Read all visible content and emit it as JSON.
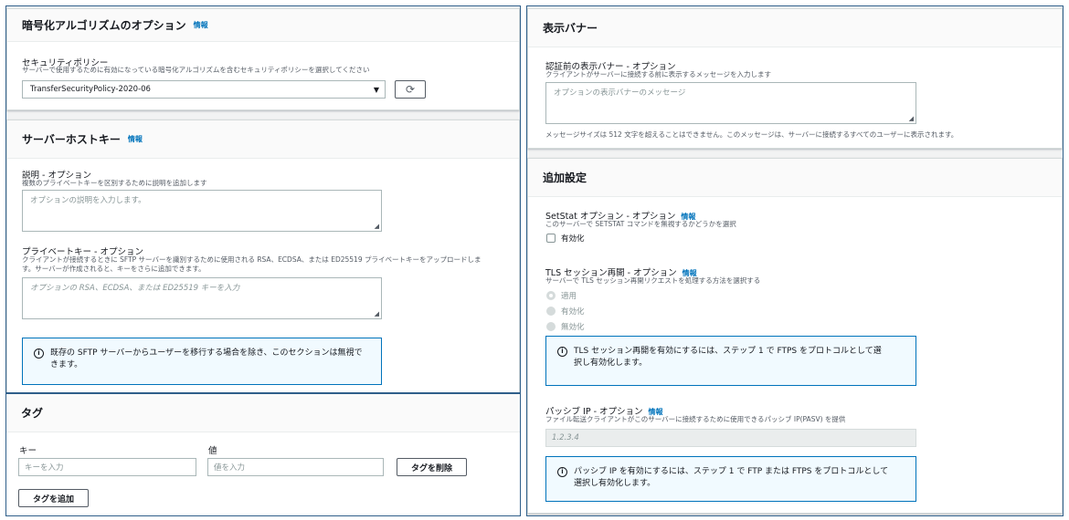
{
  "left": {
    "encryption": {
      "title": "暗号化アルゴリズムのオプション",
      "info": "情報",
      "policy_label": "セキュリティポリシー",
      "policy_desc": "サーバーで使用するために有効になっている暗号化アルゴリズムを含むセキュリティポリシーを選択してください",
      "policy_value": "TransferSecurityPolicy-2020-06"
    },
    "hostkey": {
      "title": "サーバーホストキー",
      "info": "情報",
      "desc_label": "説明 - オプション",
      "desc_desc": "複数のプライベートキーを区別するために説明を追加します",
      "desc_placeholder": "オプションの説明を入力します。",
      "pk_label": "プライベートキー - オプション",
      "pk_desc_1": "クライアントが接続するときに SFTP サーバーを識別するために使用される RSA、ECDSA、または ED25519 プライベートキーをアップロードしま",
      "pk_desc_2": "す。サーバーが作成されると、キーをさらに追加できます。",
      "pk_placeholder": "オプションの RSA、ECDSA、または ED25519 キーを入力",
      "alert_1": "既存の SFTP サーバーからユーザーを移行する場合を除き、このセクションは無視で",
      "alert_2": "きます。"
    },
    "tags": {
      "title": "タグ",
      "key_label": "キー",
      "value_label": "値",
      "key_placeholder": "キーを入力",
      "value_placeholder": "値を入力",
      "remove_button": "タグを削除",
      "add_button": "タグを追加"
    }
  },
  "right": {
    "banner": {
      "title": "表示バナー",
      "label": "認証前の表示バナー - オプション",
      "desc": "クライアントがサーバーに接続する前に表示するメッセージを入力します",
      "placeholder": "オプションの表示バナーのメッセージ",
      "note": "メッセージサイズは 512 文字を超えることはできません。このメッセージは、サーバーに接続するすべてのユーザーに表示されます。"
    },
    "additional": {
      "title": "追加設定",
      "setstat_label": "SetStat オプション - オプション",
      "setstat_info": "情報",
      "setstat_desc": "このサーバーで SETSTAT コマンドを無視するかどうかを選択",
      "setstat_checkbox": "有効化",
      "tls_label": "TLS セッション再開 - オプション",
      "tls_info": "情報",
      "tls_desc": "サーバーで TLS セッション再開リクエストを処理する方法を選択する",
      "tls_options": [
        "適用",
        "有効化",
        "無効化"
      ],
      "tls_alert_1": "TLS セッション再開を有効にするには、ステップ 1 で FTPS をプロトコルとして選",
      "tls_alert_2": "択し有効化します。",
      "passive_label": "パッシブ IP - オプション",
      "passive_info": "情報",
      "passive_desc": "ファイル転送クライアントがこのサーバーに接続するために使用できるパッシブ IP(PASV) を提供",
      "passive_placeholder": "1.2.3.4",
      "passive_alert_1": "パッシブ IP を有効にするには、ステップ 1 で FTP または FTPS をプロトコルとして",
      "passive_alert_2": "選択し有効化します。"
    }
  },
  "colors": {
    "link": "#0073bb",
    "alert_border": "#0073bb",
    "alert_bg": "#f1faff",
    "panel_border": "#2f5f8a"
  },
  "icons": [
    "refresh-icon",
    "caret-down-icon",
    "info-circle-icon",
    "resize-grip-icon"
  ]
}
